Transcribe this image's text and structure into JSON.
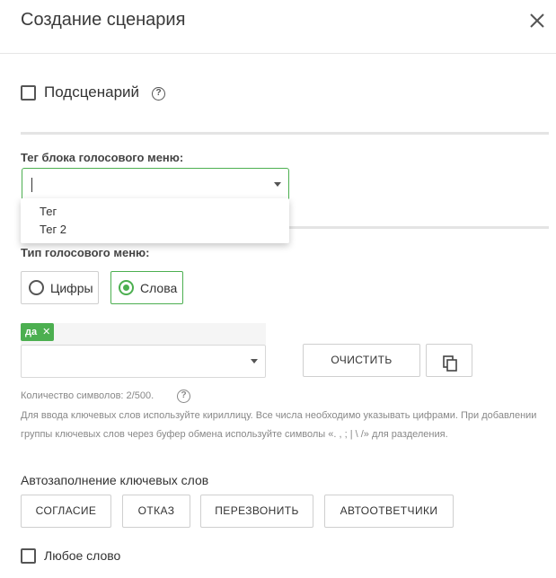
{
  "dialog": {
    "title": "Создание сценария"
  },
  "subscenario": {
    "label": "Подсценарий",
    "checked": false
  },
  "tag_block": {
    "label": "Тег блока голосового меню:",
    "value": "",
    "options": [
      "Тег",
      "Тег 2"
    ]
  },
  "menu_type": {
    "label": "Тип голосового меню:",
    "options": [
      {
        "label": "Цифры",
        "selected": false
      },
      {
        "label": "Слова",
        "selected": true
      }
    ]
  },
  "keywords": {
    "chips": [
      {
        "label": "да"
      }
    ],
    "clear_button": "ОЧИСТИТЬ",
    "char_count": "Количество символов: 2/500.",
    "hint": "Для ввода ключевых слов используйте кириллицу. Все числа необходимо указывать цифрами. При добавлении группы ключевых слов через буфер обмена используйте символы «. , ; | \\ /» для разделения."
  },
  "autofill": {
    "label": "Автозаполнение ключевых слов",
    "buttons": [
      "СОГЛАСИЕ",
      "ОТКАЗ",
      "ПЕРЕЗВОНИТЬ",
      "АВТООТВЕТЧИКИ"
    ]
  },
  "any_word": {
    "label": "Любое слово",
    "checked": false
  },
  "colors": {
    "accent": "#4caf50",
    "divider": "#e4e4e4"
  }
}
